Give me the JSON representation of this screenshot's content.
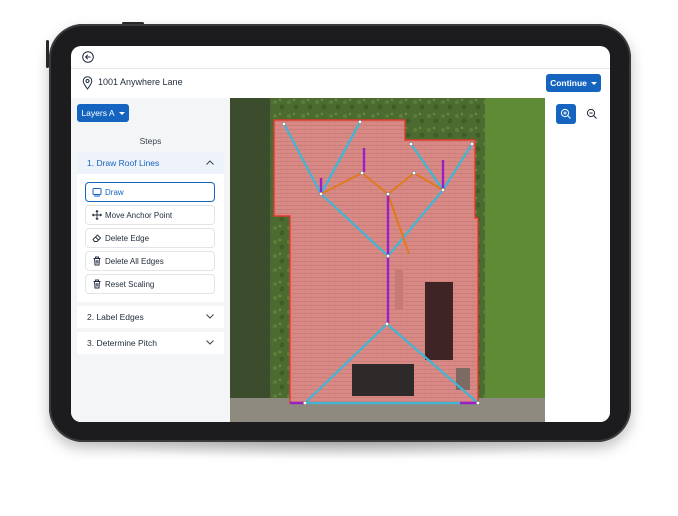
{
  "address": "1001 Anywhere Lane",
  "continue_label": "Continue",
  "layers_label": "Layers A",
  "steps_title": "Steps",
  "steps": [
    {
      "label": "1. Draw Roof Lines",
      "expanded": true
    },
    {
      "label": "2. Label Edges",
      "expanded": false
    },
    {
      "label": "3. Determine Pitch",
      "expanded": false
    }
  ],
  "tools": [
    {
      "label": "Draw",
      "icon": "square-icon",
      "selected": true
    },
    {
      "label": "Move Anchor Point",
      "icon": "move-arrows-icon",
      "selected": false
    },
    {
      "label": "Delete Edge",
      "icon": "eraser-icon",
      "selected": false
    },
    {
      "label": "Delete All Edges",
      "icon": "trash-icon",
      "selected": false
    },
    {
      "label": "Reset Scaling",
      "icon": "trash-icon",
      "selected": false
    }
  ],
  "colors": {
    "primary": "#1565c0",
    "roof": "#d98a86",
    "ridge_purple": "#9b1fc9",
    "hip_cyan": "#3fb6d6",
    "valley_orange": "#e07a1f",
    "eave_red": "#e23b2e",
    "grass": "#4c6b30"
  }
}
